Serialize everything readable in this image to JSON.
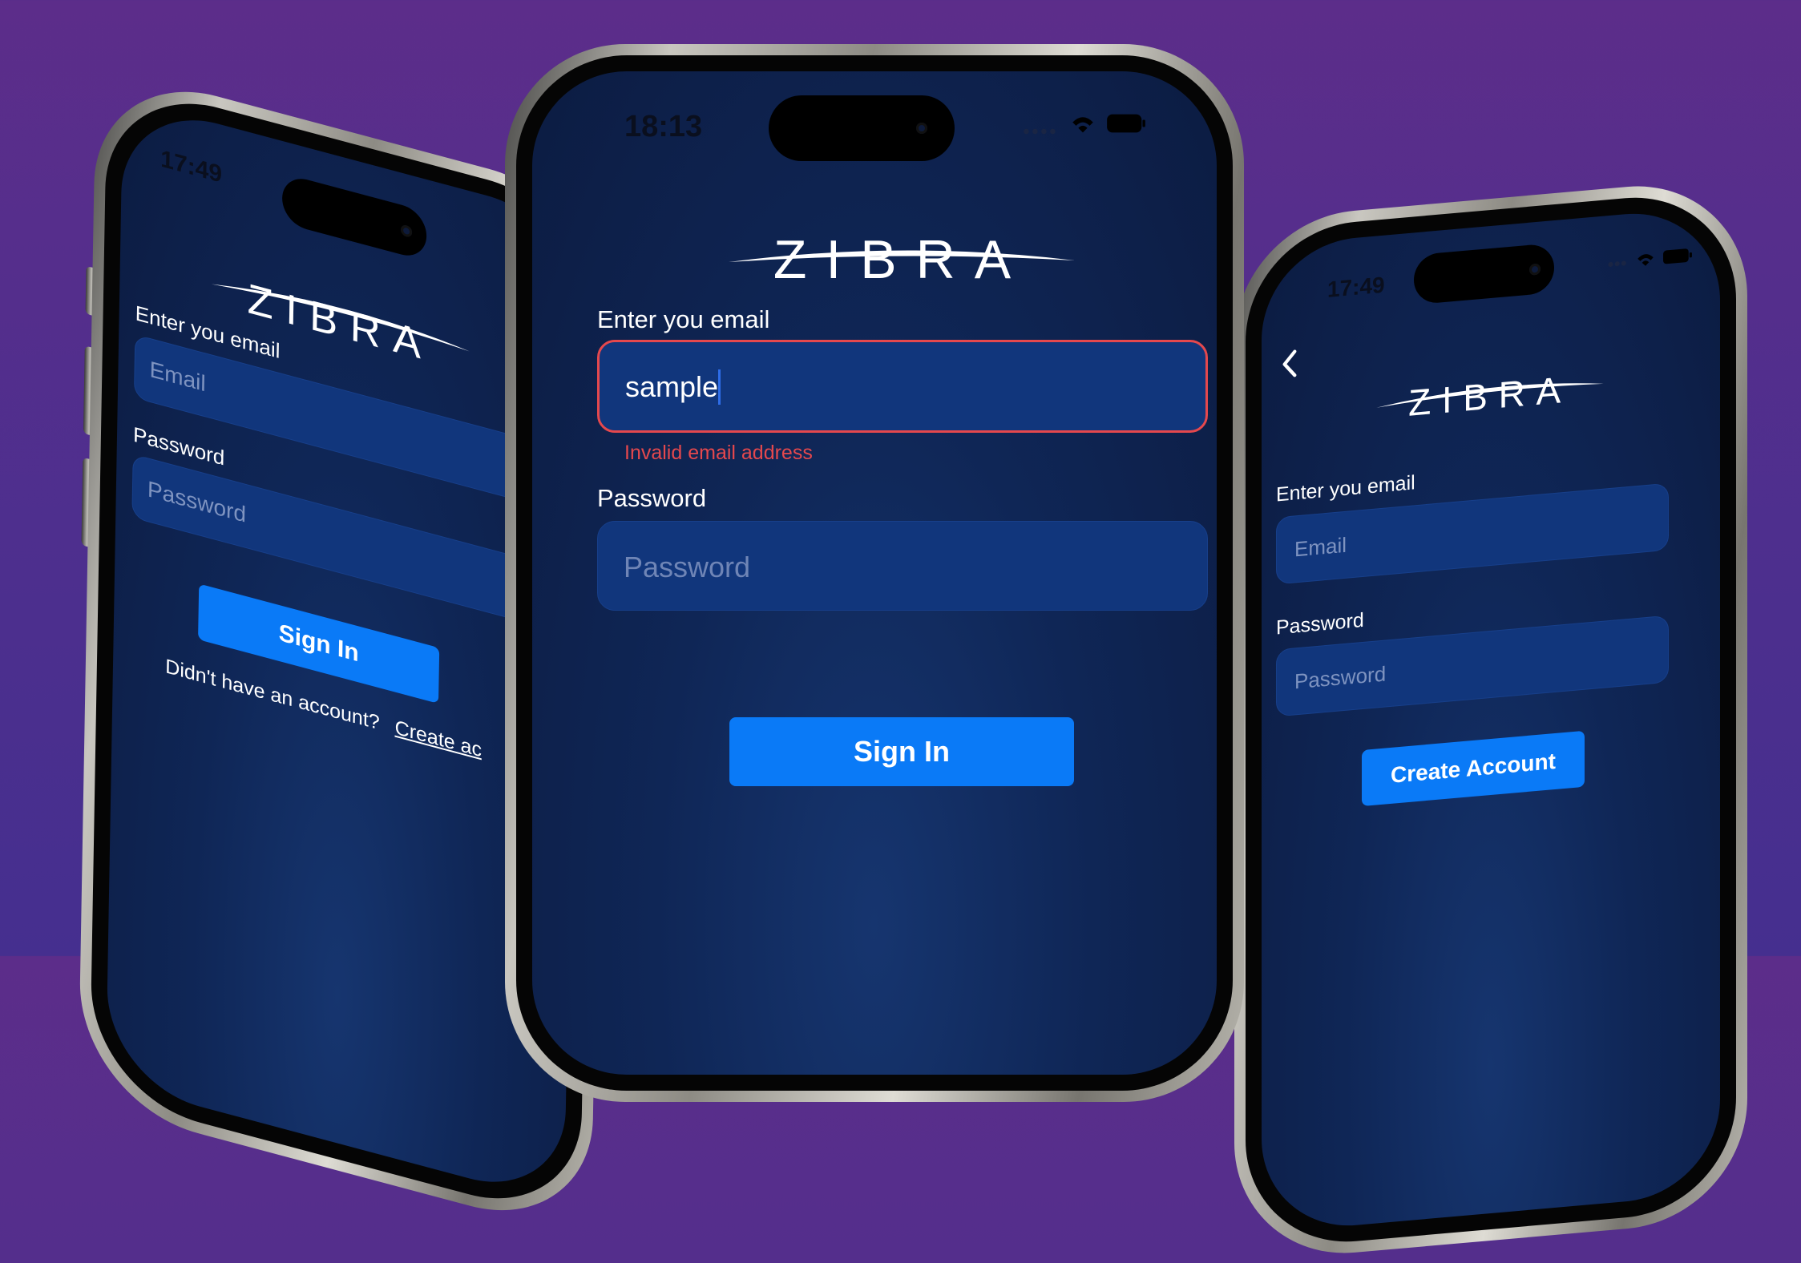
{
  "brand": "ZIBRA",
  "left_phone": {
    "time": "17:49",
    "email_label": "Enter you email",
    "email_placeholder": "Email",
    "password_label": "Password",
    "password_placeholder": "Password",
    "signin_label": "Sign In",
    "footer_text": "Didn't have an account?",
    "footer_link": "Create ac"
  },
  "center_phone": {
    "time": "18:13",
    "email_label": "Enter you email",
    "email_value": "sample",
    "email_error": "Invalid email address",
    "password_label": "Password",
    "password_placeholder": "Password",
    "signin_label": "Sign In",
    "colors": {
      "error": "#e5484d",
      "accent": "#0a7af7",
      "field_bg": "#11367c"
    }
  },
  "right_phone": {
    "time": "17:49",
    "email_label": "Enter you email",
    "email_placeholder": "Email",
    "password_label": "Password",
    "password_placeholder": "Password",
    "create_label": "Create Account",
    "back_icon": "chevron-left-icon"
  }
}
